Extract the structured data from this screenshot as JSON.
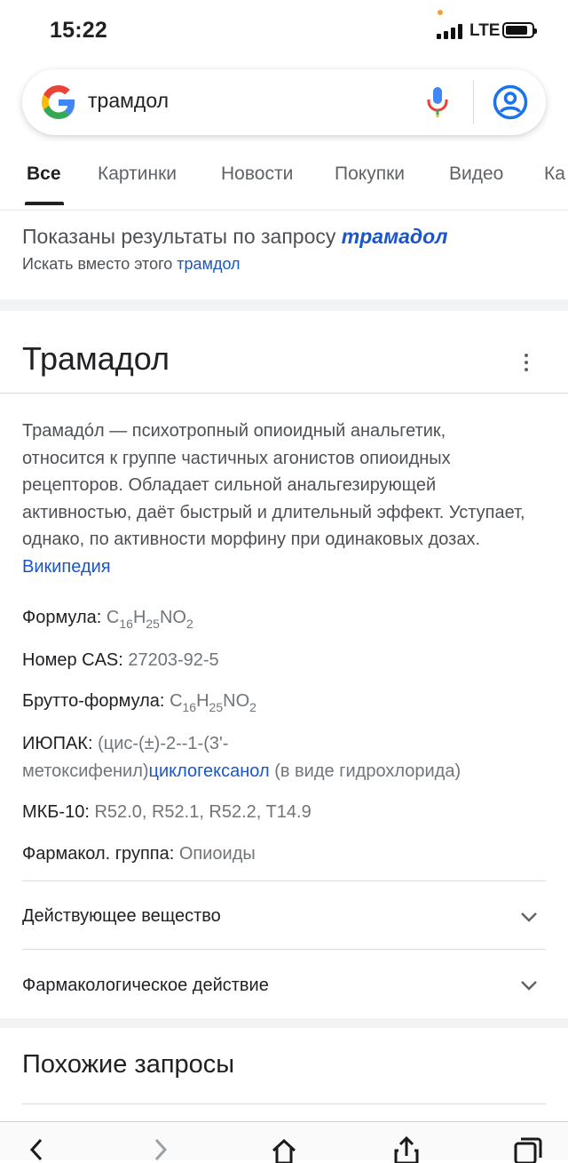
{
  "status_bar": {
    "time": "15:22",
    "network": "LTE"
  },
  "search": {
    "query": "трамдол"
  },
  "tabs": [
    {
      "label": "Все",
      "active": true
    },
    {
      "label": "Картинки"
    },
    {
      "label": "Новости"
    },
    {
      "label": "Покупки"
    },
    {
      "label": "Видео"
    },
    {
      "label": "Ка"
    }
  ],
  "spelling": {
    "shown_prefix": "Показаны результаты по запросу",
    "corrected": "трамадол",
    "instead_prefix": "Искать вместо этого",
    "original": "трамдол"
  },
  "knowledge_panel": {
    "title": "Трамадол",
    "description": "Трамадóл — психотропный опиоидный анальгетик, относится к группе частичных агонистов опиоидных рецепторов. Обладает сильной анальгезирующей активностью, даёт быстрый и длительный эффект. Уступает, однако, по активности морфину при одинаковых дозах.",
    "source_link": "Википедия",
    "facts": {
      "formula_label": "Формула:",
      "formula": {
        "c": "C",
        "c_n": "16",
        "h": "H",
        "h_n": "25",
        "no": "NO",
        "no_n": "2"
      },
      "cas_label": "Номер CAS:",
      "cas": "27203-92-5",
      "brutto_label": "Брутто-формула:",
      "iupac_label": "ИЮПАК:",
      "iupac_line1": "(цис-(±)-2--1-(3'-",
      "iupac_line2_a": "метоксифенил)",
      "iupac_line2_link": "циклогексанол",
      "iupac_line2_b": "(в виде гидрохлорида)",
      "icd_label": "МКБ-10:",
      "icd": "R52.0, R52.1, R52.2, T14.9",
      "pharm_label": "Фармакол. группа:",
      "pharm": "Опиоиды"
    },
    "accordions": [
      {
        "label": "Действующее вещество"
      },
      {
        "label": "Фармакологическое действие"
      }
    ]
  },
  "related": {
    "title": "Похожие запросы"
  },
  "colors": {
    "link": "#1a56c9",
    "text": "#202124",
    "muted": "#70757a"
  }
}
